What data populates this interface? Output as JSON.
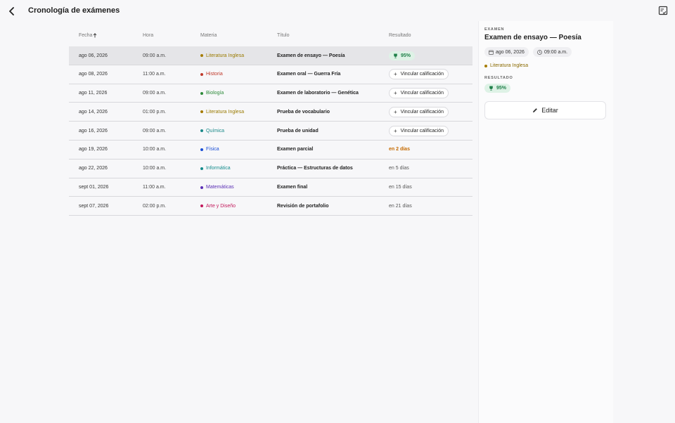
{
  "header": {
    "title": "Cronología de exámenes"
  },
  "table": {
    "columns": {
      "date": "Fecha",
      "time": "Hora",
      "subject": "Materia",
      "title": "Título",
      "result": "Resultado"
    },
    "rows": [
      {
        "date": "ago 06, 2026",
        "time": "09:00 a.m.",
        "subject": "Literatura Inglesa",
        "subject_color": "#9a7a00",
        "dot_color": "#a67c00",
        "title": "Examen de ensayo — Poesía",
        "result_type": "score",
        "result": "95%",
        "selected": true
      },
      {
        "date": "ago 08, 2026",
        "time": "11:00 a.m.",
        "subject": "Historia",
        "subject_color": "#c0392b",
        "dot_color": "#c0392b",
        "title": "Examen oral — Guerra Fría",
        "result_type": "link",
        "result": "Vincular calificación"
      },
      {
        "date": "ago 11, 2026",
        "time": "09:00 a.m.",
        "subject": "Biología",
        "subject_color": "#2e8b3a",
        "dot_color": "#2e8b3a",
        "title": "Examen de laboratorio — Genética",
        "result_type": "link",
        "result": "Vincular calificación"
      },
      {
        "date": "ago 14, 2026",
        "time": "01:00 p.m.",
        "subject": "Literatura Inglesa",
        "subject_color": "#9a7a00",
        "dot_color": "#a67c00",
        "title": "Prueba de vocabulario",
        "result_type": "link",
        "result": "Vincular calificación"
      },
      {
        "date": "ago 16, 2026",
        "time": "09:00 a.m.",
        "subject": "Química",
        "subject_color": "#1b8a8a",
        "dot_color": "#1b8a8a",
        "title": "Prueba de unidad",
        "result_type": "link",
        "result": "Vincular calificación"
      },
      {
        "date": "ago 19, 2026",
        "time": "10:00 a.m.",
        "subject": "Física",
        "subject_color": "#1a4fd6",
        "dot_color": "#1a4fd6",
        "title": "Examen parcial",
        "result_type": "soon",
        "result": "en 2 días"
      },
      {
        "date": "ago 22, 2026",
        "time": "10:00 a.m.",
        "subject": "Informática",
        "subject_color": "#148c8c",
        "dot_color": "#148c8c",
        "title": "Práctica — Estructuras de datos",
        "result_type": "due",
        "result": "en 5 días"
      },
      {
        "date": "sept 01, 2026",
        "time": "11:00 a.m.",
        "subject": "Matemáticas",
        "subject_color": "#5b2fb5",
        "dot_color": "#5b2fb5",
        "title": "Examen final",
        "result_type": "due",
        "result": "en 15 días"
      },
      {
        "date": "sept 07, 2026",
        "time": "02:00 p.m.",
        "subject": "Arte y Diseño",
        "subject_color": "#c2185b",
        "dot_color": "#c2185b",
        "title": "Revisión de portafolio",
        "result_type": "due",
        "result": "en 21 días"
      }
    ]
  },
  "panel": {
    "kind_label": "EXAMEN",
    "title": "Examen de ensayo — Poesía",
    "date": "ago 06, 2026",
    "time": "09:00 a.m.",
    "subject": "Literatura Inglesa",
    "result_label": "RESULTADO",
    "result": "95%",
    "edit_label": "Editar"
  },
  "colors": {
    "accent_green": "#20804a",
    "soon": "#c56a00"
  },
  "icons": {
    "back": "chevron-left-icon",
    "notes": "notes-icon",
    "sort": "arrow-up-icon",
    "trophy": "trophy-icon",
    "calendar": "calendar-icon",
    "clock": "clock-icon",
    "edit": "pencil-icon"
  }
}
